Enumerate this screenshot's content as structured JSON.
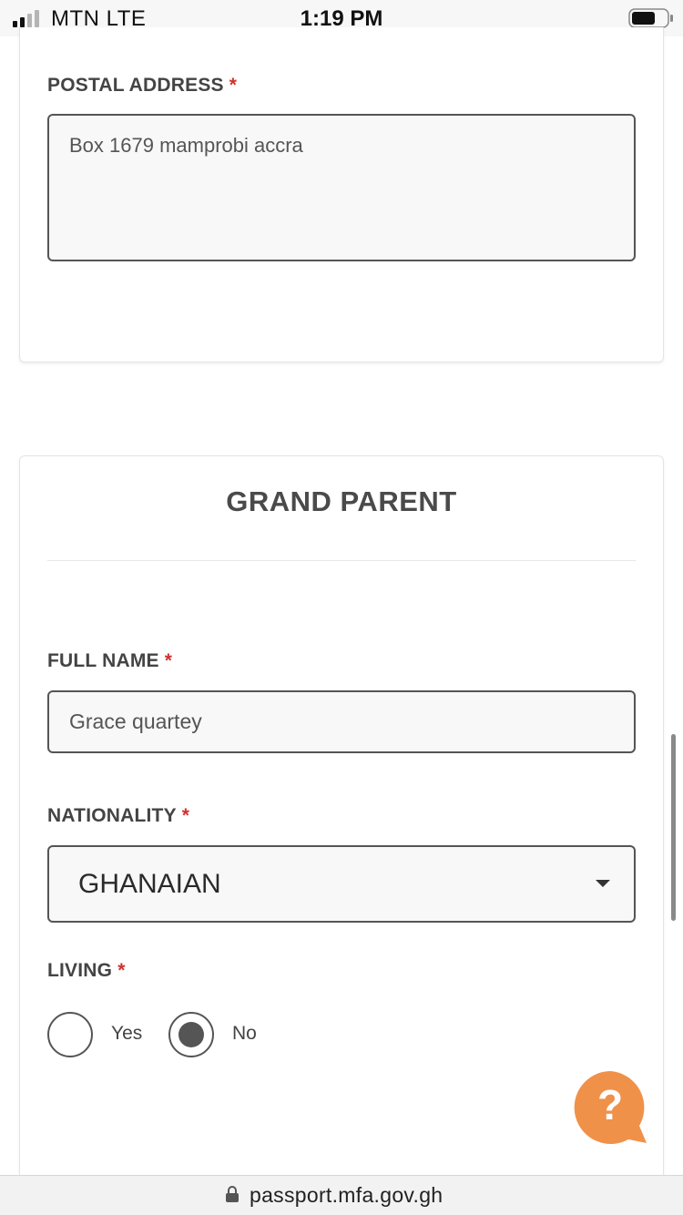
{
  "status_bar": {
    "carrier": "MTN  LTE",
    "time": "1:19 PM",
    "signal_icon": "cellular-signal-icon",
    "battery_icon": "battery-icon"
  },
  "postal_address": {
    "label": "POSTAL ADDRESS",
    "required_mark": "*",
    "value": "Box 1679 mamprobi accra"
  },
  "grand_parent": {
    "title": "GRAND PARENT",
    "full_name": {
      "label": "FULL NAME",
      "required_mark": "*",
      "value": "Grace quartey"
    },
    "nationality": {
      "label": "NATIONALITY",
      "required_mark": "*",
      "selected": "GHANAIAN",
      "icon": "chevron-down-icon"
    },
    "living": {
      "label": "LIVING",
      "required_mark": "*",
      "options": [
        {
          "label": "Yes",
          "selected": false
        },
        {
          "label": "No",
          "selected": true
        }
      ]
    }
  },
  "help_button": {
    "symbol": "?",
    "icon": "help-chat-icon",
    "color": "#f0914a"
  },
  "url_bar": {
    "url": "passport.mfa.gov.gh",
    "icon": "lock-icon"
  },
  "colors": {
    "required": "#d0312d",
    "help": "#f0914a",
    "border": "#555555"
  }
}
